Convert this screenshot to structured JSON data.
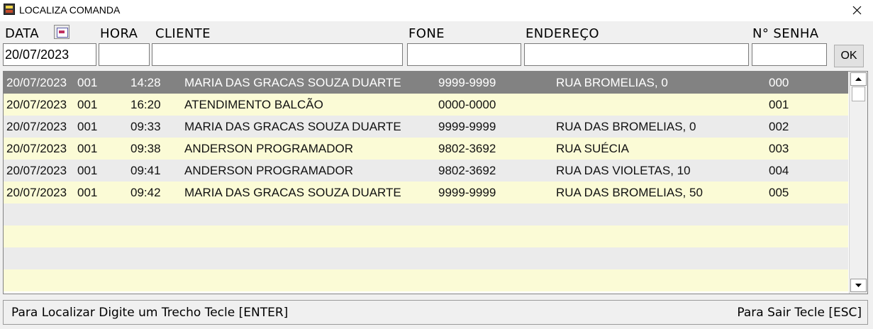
{
  "window": {
    "title": "LOCALIZA COMANDA",
    "icon": "app-icon",
    "close_icon": "close-icon"
  },
  "search": {
    "headers": {
      "data": "DATA",
      "hora": "HORA",
      "cliente": "CLIENTE",
      "fone": "FONE",
      "endereco": "ENDEREÇO",
      "senha": "N° SENHA"
    },
    "calendar_icon": "calendar-icon",
    "values": {
      "data": "20/07/2023",
      "hora": "",
      "cliente": "",
      "fone": "",
      "endereco": "",
      "senha": ""
    },
    "ok_label": "OK"
  },
  "grid": {
    "rows": [
      [
        "20/07/2023",
        "001",
        "14:28",
        "MARIA DAS GRACAS SOUZA DUARTE",
        "9999-9999",
        "RUA BROMELIAS, 0",
        "000"
      ],
      [
        "20/07/2023",
        "001",
        "16:20",
        "ATENDIMENTO BALCÃO",
        "0000-0000",
        "",
        "001"
      ],
      [
        "20/07/2023",
        "001",
        "09:33",
        "MARIA DAS GRACAS SOUZA DUARTE",
        "9999-9999",
        "RUA DAS BROMELIAS, 0",
        "002"
      ],
      [
        "20/07/2023",
        "001",
        "09:38",
        "ANDERSON PROGRAMADOR",
        "9802-3692",
        "RUA SUÉCIA",
        "003"
      ],
      [
        "20/07/2023",
        "001",
        "09:41",
        "ANDERSON PROGRAMADOR",
        "9802-3692",
        "RUA DAS VIOLETAS, 10",
        "004"
      ],
      [
        "20/07/2023",
        "001",
        "09:42",
        "MARIA DAS GRACAS SOUZA DUARTE",
        "9999-9999",
        "RUA DAS BROMELIAS, 50",
        "005"
      ]
    ],
    "empty_rows": 4,
    "selected_index": 0,
    "colors": {
      "selected": "#828282",
      "odd": "#fbfbd6",
      "even": "#ebebeb"
    }
  },
  "status": {
    "left": "Para Localizar Digite um Trecho Tecle [ENTER]",
    "right": "Para Sair Tecle [ESC]"
  }
}
